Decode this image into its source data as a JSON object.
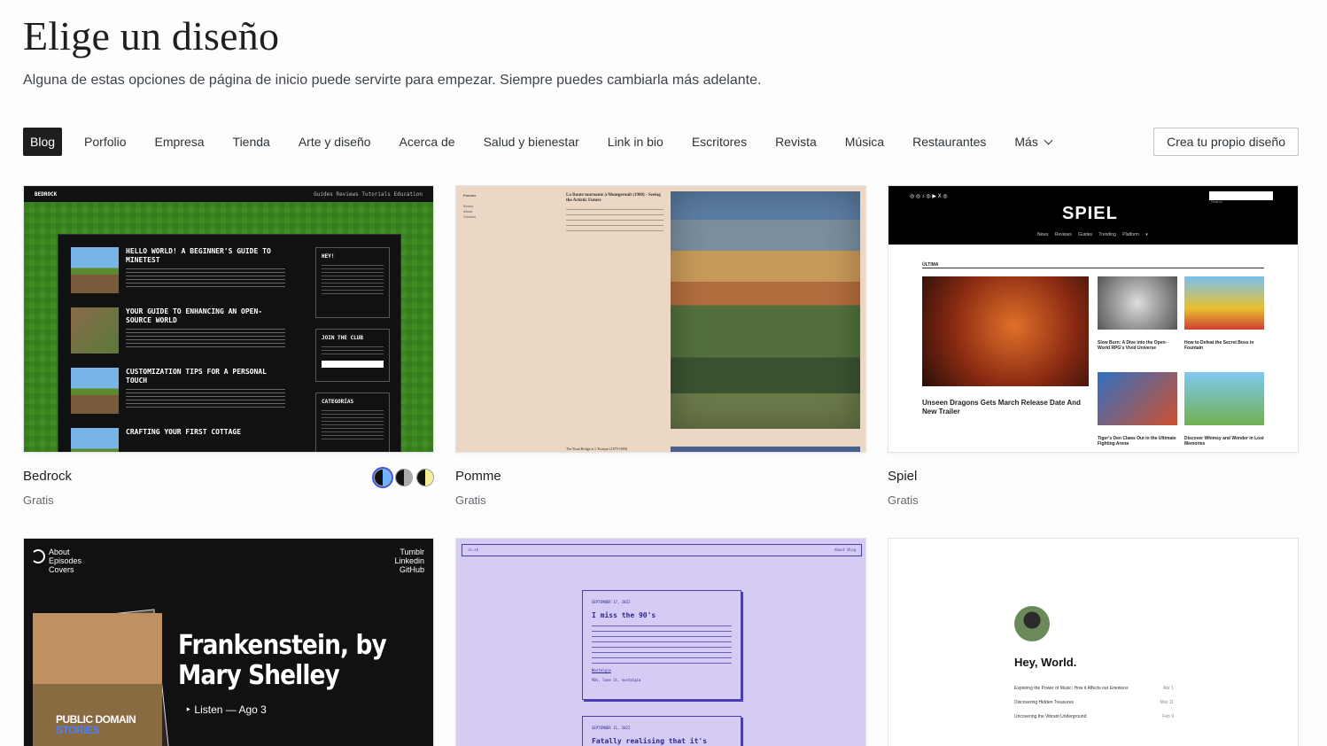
{
  "page": {
    "title": "Elige un diseño",
    "subtitle": "Alguna de estas opciones de página de inicio puede servirte para empezar. Siempre puedes cambiarla más adelante."
  },
  "tabs": [
    "Blog",
    "Porfolio",
    "Empresa",
    "Tienda",
    "Arte y diseño",
    "Acerca de",
    "Salud y bienestar",
    "Link in bio",
    "Escritores",
    "Revista",
    "Música",
    "Restaurantes"
  ],
  "more_label": "Más",
  "create_label": "Crea tu propio diseño",
  "themes": [
    {
      "name": "Bedrock",
      "price": "Gratis"
    },
    {
      "name": "Pomme",
      "price": "Gratis"
    },
    {
      "name": "Spiel",
      "price": "Gratis"
    }
  ],
  "swatch_colors": [
    [
      "#111111",
      "#6fb3ff"
    ],
    [
      "#111111",
      "#aaaaaa"
    ],
    [
      "#111111",
      "#f5ef9a"
    ]
  ],
  "bedrock": {
    "logo": "BEDROCK",
    "nav": "Guides   Reviews   Tutorials   Education",
    "posts": [
      "HELLO WORLD! A BEGINNER'S GUIDE TO MINETEST",
      "YOUR GUIDE TO ENHANCING AN OPEN-SOURCE WORLD",
      "CUSTOMIZATION TIPS FOR A PERSONAL TOUCH",
      "CRAFTING YOUR FIRST COTTAGE"
    ],
    "boxes": [
      "HEY!",
      "JOIN THE CLUB",
      "CATEGORÍAS"
    ]
  },
  "pomme": {
    "nav": "Pomme",
    "links": [
      "Books",
      "About",
      "Contact"
    ],
    "article_title": "La Route tournante à Montgeroult (1900) - Seeing the Artistic Future",
    "foot": "The Road Bridge at L'Estaque (1879-1880)"
  },
  "spiel": {
    "logo": "SPIEL",
    "icons": "◎ ◎ ♪ ◎ ▶ X ◎",
    "menu": "News Reviews Guides Trending Platform ▾",
    "search": "Search",
    "label": "ÚLTIMA",
    "main_headline": "Unseen Dragons Gets March Release Date And New Trailer",
    "side_headlines": [
      "Slow Burn: A Dive into the Open-World RPG's Vivid Universe",
      "How to Defeat the Secret Boss in Fountain",
      "Tiger's Den Claws Out in the Ultimate Fighting Arena",
      "Discover Whimsy and Wonder in Lost Memories"
    ]
  },
  "frank": {
    "left_nav": [
      "About",
      "Episodes",
      "Covers"
    ],
    "right_nav": [
      "Tumblr",
      "Linkedin",
      "GitHub"
    ],
    "headline": "Frankenstein, by Mary Shelley",
    "headline_l1": "Frankenstein, by",
    "headline_l2": "Mary Shelley",
    "listen": "‣ Listen — Ago 3",
    "pd1": "PUBLIC DOMAIN",
    "pd2": "STORIES"
  },
  "io": {
    "left": "io.sk",
    "right": "About  Blog",
    "posts": [
      {
        "date": "SEPTEMBER 17, 2022",
        "title": "I miss the 90's",
        "tag": "Nostalgia",
        "tags2": "90s, love it, nostalgia"
      },
      {
        "date": "SEPTEMBER 11, 2022",
        "title": "Fatally realising that it's"
      }
    ]
  },
  "hello": {
    "heading": "Hey, World.",
    "rows": [
      {
        "t": "Exploring the Power of Music: How it Affects our Emotions",
        "d": "Abr 1"
      },
      {
        "t": "Discovering Hidden Treasures",
        "d": "Mar 11"
      },
      {
        "t": "Uncovering the Vibrant Underground",
        "d": "Feb 9"
      }
    ]
  }
}
